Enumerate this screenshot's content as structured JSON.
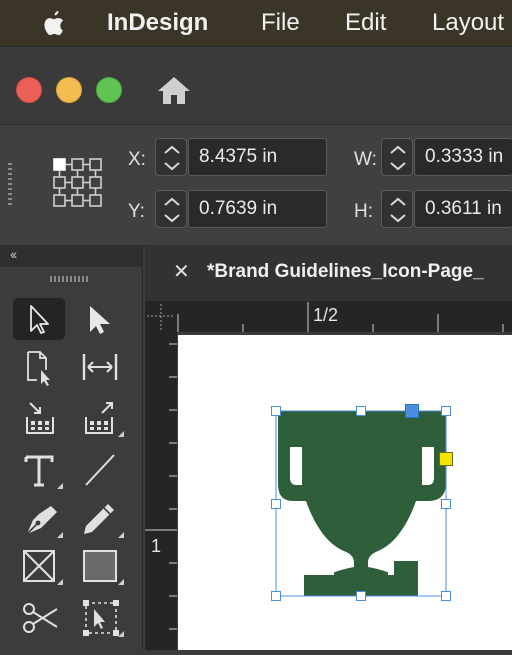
{
  "menubar": {
    "app_name": "InDesign",
    "items": [
      "File",
      "Edit",
      "Layout"
    ]
  },
  "control": {
    "x_label": "X:",
    "x_value": "8.4375 in",
    "y_label": "Y:",
    "y_value": "0.7639 in",
    "w_label": "W:",
    "w_value": "0.3333 in",
    "h_label": "H:",
    "h_value": "0.3611 in"
  },
  "document": {
    "tab_title": "*Brand Guidelines_Icon-Page_",
    "ruler_top_label": "1/2",
    "ruler_left_label": "1"
  },
  "colors": {
    "trophy": "#2f5e3b",
    "selection": "#4a8ee0",
    "handle_active": "#4a8ee0",
    "handle_out_port": "#f5e400"
  },
  "icons": {
    "tools": [
      "selection-tool",
      "direct-selection-tool",
      "page-tool",
      "gap-tool",
      "content-collector-tool",
      "content-placer-tool",
      "type-tool",
      "line-tool",
      "pen-tool",
      "pencil-tool",
      "rectangle-frame-tool",
      "rectangle-tool",
      "scissors-tool",
      "free-transform-tool"
    ]
  }
}
